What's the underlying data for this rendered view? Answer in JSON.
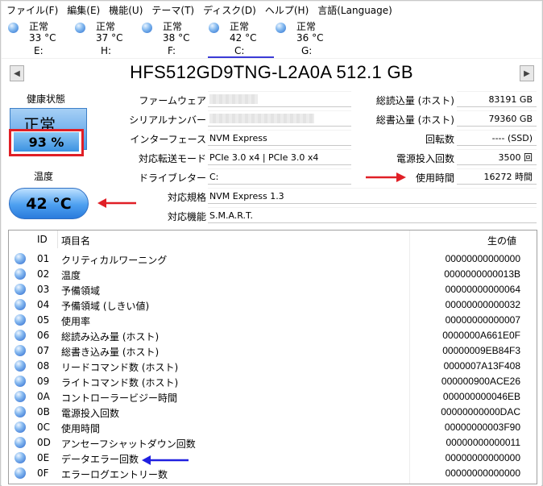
{
  "menu": [
    "ファイル(F)",
    "編集(E)",
    "機能(U)",
    "テーマ(T)",
    "ディスク(D)",
    "ヘルプ(H)",
    "言語(Language)"
  ],
  "drives": [
    {
      "status": "正常",
      "temp": "33 °C",
      "letter": "E:"
    },
    {
      "status": "正常",
      "temp": "37 °C",
      "letter": "H:"
    },
    {
      "status": "正常",
      "temp": "38 °C",
      "letter": "F:"
    },
    {
      "status": "正常",
      "temp": "42 °C",
      "letter": "C:"
    },
    {
      "status": "正常",
      "temp": "36 °C",
      "letter": "G:"
    }
  ],
  "active_drive": "C:",
  "model": "HFS512GD9TNG-L2A0A 512.1 GB",
  "nav": {
    "prev": "◀",
    "next": "▶"
  },
  "health": {
    "label": "健康状態",
    "status": "正常",
    "percent": "93 %"
  },
  "temperature": {
    "label": "温度",
    "value": "42 °C"
  },
  "info": {
    "firmware_label": "ファームウェア",
    "serial_label": "シリアルナンバー",
    "interface_label": "インターフェース",
    "interface": "NVM Express",
    "transfer_label": "対応転送モード",
    "transfer": "PCIe 3.0 x4 | PCIe 3.0 x4",
    "letter_label": "ドライブレター",
    "letter": "C:",
    "standard_label": "対応規格",
    "standard": "NVM Express 1.3",
    "features_label": "対応機能",
    "features": "S.M.A.R.T."
  },
  "stats": {
    "host_reads_label": "総読込量 (ホスト)",
    "host_reads": "83191 GB",
    "host_writes_label": "総書込量 (ホスト)",
    "host_writes": "79360 GB",
    "rotation_label": "回転数",
    "rotation": "---- (SSD)",
    "power_count_label": "電源投入回数",
    "power_count": "3500 回",
    "hours_label": "使用時間",
    "hours": "16272 時間"
  },
  "table": {
    "headers": {
      "id": "ID",
      "name": "項目名",
      "raw": "生の値"
    },
    "rows": [
      {
        "id": "01",
        "name": "クリティカルワーニング",
        "raw": "00000000000000"
      },
      {
        "id": "02",
        "name": "温度",
        "raw": "0000000000013B"
      },
      {
        "id": "03",
        "name": "予備領域",
        "raw": "00000000000064"
      },
      {
        "id": "04",
        "name": "予備領域 (しきい値)",
        "raw": "00000000000032"
      },
      {
        "id": "05",
        "name": "使用率",
        "raw": "00000000000007"
      },
      {
        "id": "06",
        "name": "総読み込み量 (ホスト)",
        "raw": "0000000A661E0F"
      },
      {
        "id": "07",
        "name": "総書き込み量 (ホスト)",
        "raw": "00000009EB84F3"
      },
      {
        "id": "08",
        "name": "リードコマンド数 (ホスト)",
        "raw": "0000007A13F408"
      },
      {
        "id": "09",
        "name": "ライトコマンド数 (ホスト)",
        "raw": "000000900ACE26"
      },
      {
        "id": "0A",
        "name": "コントローラービジー時間",
        "raw": "000000000046EB"
      },
      {
        "id": "0B",
        "name": "電源投入回数",
        "raw": "00000000000DAC"
      },
      {
        "id": "0C",
        "name": "使用時間",
        "raw": "00000000003F90"
      },
      {
        "id": "0D",
        "name": "アンセーフシャットダウン回数",
        "raw": "00000000000011"
      },
      {
        "id": "0E",
        "name": "データエラー回数",
        "raw": "00000000000000"
      },
      {
        "id": "0F",
        "name": "エラーログエントリー数",
        "raw": "00000000000000"
      }
    ]
  },
  "colors": {
    "accent": "#3b3bd6",
    "health_blue": "#4a98e6",
    "highlight_red": "#e01f26",
    "arrow_blue": "#2020e0"
  }
}
